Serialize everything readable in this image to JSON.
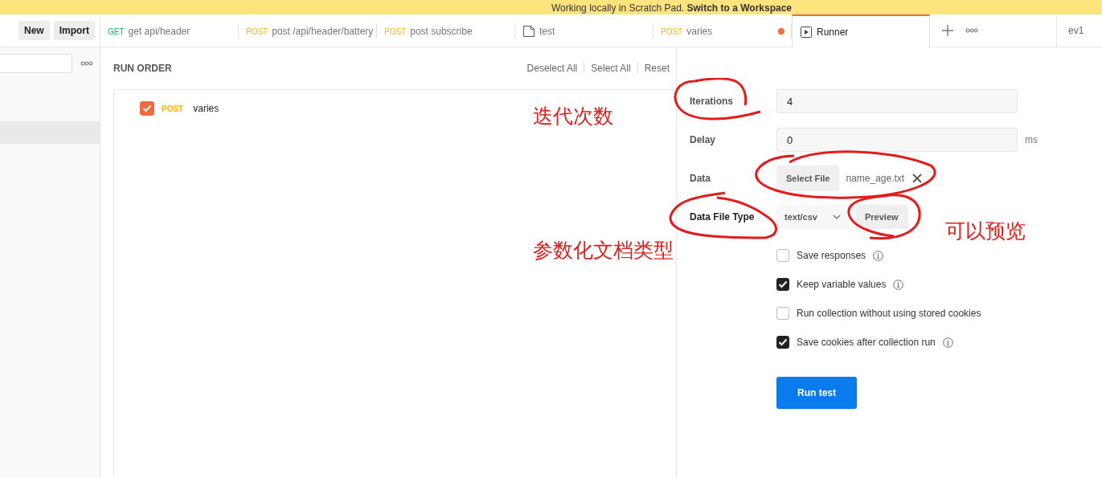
{
  "banner": {
    "text": "Working locally in Scratch Pad.",
    "link": "Switch to a Workspace"
  },
  "sidebar": {
    "buttons": [
      "New",
      "Import"
    ]
  },
  "tabs": [
    {
      "method": "GET",
      "label": "get api/header",
      "kind": "request",
      "selected": false,
      "unsaved": false
    },
    {
      "method": "POST",
      "label": "post /api/header/battery",
      "kind": "request",
      "selected": false,
      "unsaved": false
    },
    {
      "method": "POST",
      "label": "post subscribe",
      "kind": "request",
      "selected": false,
      "unsaved": false
    },
    {
      "label": "test",
      "kind": "doc",
      "selected": false,
      "unsaved": false
    },
    {
      "method": "POST",
      "label": "varies",
      "kind": "request",
      "selected": false,
      "unsaved": true
    },
    {
      "label": "Runner",
      "kind": "runner",
      "selected": true,
      "unsaved": false
    }
  ],
  "environment": "ev1",
  "run_order": {
    "title": "RUN ORDER",
    "actions": [
      "Deselect All",
      "Select All",
      "Reset"
    ],
    "items": [
      {
        "method": "POST",
        "name": "varies",
        "checked": true
      }
    ]
  },
  "settings": {
    "iterations": {
      "label": "Iterations",
      "value": "4"
    },
    "delay": {
      "label": "Delay",
      "value": "0",
      "unit": "ms"
    },
    "data": {
      "label": "Data",
      "button": "Select File",
      "file": "name_age.txt"
    },
    "file_type": {
      "label": "Data File Type",
      "value": "text/csv",
      "button": "Preview"
    },
    "options": [
      {
        "label": "Save responses",
        "checked": false,
        "info": true
      },
      {
        "label": "Keep variable values",
        "checked": true,
        "info": true
      },
      {
        "label": "Run collection without using stored cookies",
        "checked": false,
        "info": false
      },
      {
        "label": "Save cookies after collection run",
        "checked": true,
        "info": true
      }
    ],
    "run_button": "Run test"
  },
  "annotations": [
    {
      "text": "迭代次数"
    },
    {
      "text": "参数化文档类型"
    },
    {
      "text": "可以预览"
    }
  ]
}
